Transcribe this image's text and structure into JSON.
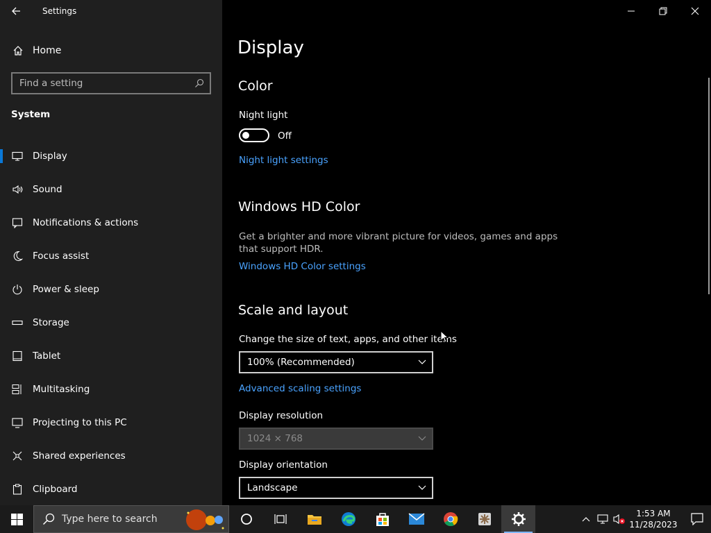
{
  "window": {
    "title": "Settings"
  },
  "sidebar": {
    "home_label": "Home",
    "search_placeholder": "Find a setting",
    "section_title": "System",
    "items": [
      {
        "label": "Display",
        "icon": "monitor-icon",
        "active": true
      },
      {
        "label": "Sound",
        "icon": "speaker-icon"
      },
      {
        "label": "Notifications & actions",
        "icon": "notification-icon"
      },
      {
        "label": "Focus assist",
        "icon": "moon-icon"
      },
      {
        "label": "Power & sleep",
        "icon": "power-icon"
      },
      {
        "label": "Storage",
        "icon": "storage-icon"
      },
      {
        "label": "Tablet",
        "icon": "tablet-icon"
      },
      {
        "label": "Multitasking",
        "icon": "multitasking-icon"
      },
      {
        "label": "Projecting to this PC",
        "icon": "projecting-icon"
      },
      {
        "label": "Shared experiences",
        "icon": "shared-icon"
      },
      {
        "label": "Clipboard",
        "icon": "clipboard-icon"
      }
    ]
  },
  "main": {
    "page_title": "Display",
    "color": {
      "heading": "Color",
      "night_light_label": "Night light",
      "night_light_state": "Off",
      "night_light_link": "Night light settings"
    },
    "hdr": {
      "heading": "Windows HD Color",
      "description": "Get a brighter and more vibrant picture for videos, games and apps that support HDR.",
      "link": "Windows HD Color settings"
    },
    "scale": {
      "heading": "Scale and layout",
      "size_label": "Change the size of text, apps, and other items",
      "size_value": "100% (Recommended)",
      "advanced_link": "Advanced scaling settings",
      "resolution_label": "Display resolution",
      "resolution_value": "1024 × 768",
      "orientation_label": "Display orientation",
      "orientation_value": "Landscape"
    }
  },
  "taskbar": {
    "search_text": "Type here to search",
    "apps": [
      "cortana-icon",
      "task-view-icon",
      "file-explorer-icon",
      "edge-icon",
      "store-icon",
      "mail-icon",
      "chrome-icon",
      "app-icon",
      "settings-icon"
    ],
    "clock_time": "1:53 AM",
    "clock_date": "11/28/2023"
  },
  "colors": {
    "accent": "#0a78d7",
    "link": "#4aa3ff",
    "sidebar_bg": "#1f1f1f"
  }
}
